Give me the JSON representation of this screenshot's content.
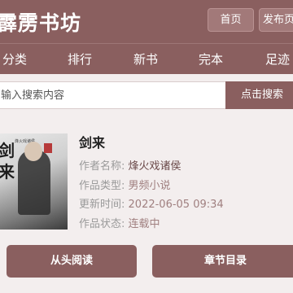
{
  "header": {
    "site_title": "霹雳书坊",
    "home_label": "首页",
    "publish_label": "发布页"
  },
  "nav": {
    "items": [
      {
        "label": "分类"
      },
      {
        "label": "排行"
      },
      {
        "label": "新书"
      },
      {
        "label": "完本"
      },
      {
        "label": "足迹"
      }
    ]
  },
  "search": {
    "placeholder": "输入搜索内容",
    "button_label": "点击搜索"
  },
  "book": {
    "cover_text": "剑来",
    "cover_subtext": "烽火戏诸侯",
    "title": "剑来",
    "author_label": "作者名称:",
    "author": "烽火戏诸侯",
    "category_label": "作品类型:",
    "category": "男频小说",
    "updated_label": "更新时间:",
    "updated": "2022-06-05 09:34",
    "status_label": "作品状态:",
    "status": "连载中"
  },
  "actions": {
    "read_label": "从头阅读",
    "chapters_label": "章节目录"
  }
}
